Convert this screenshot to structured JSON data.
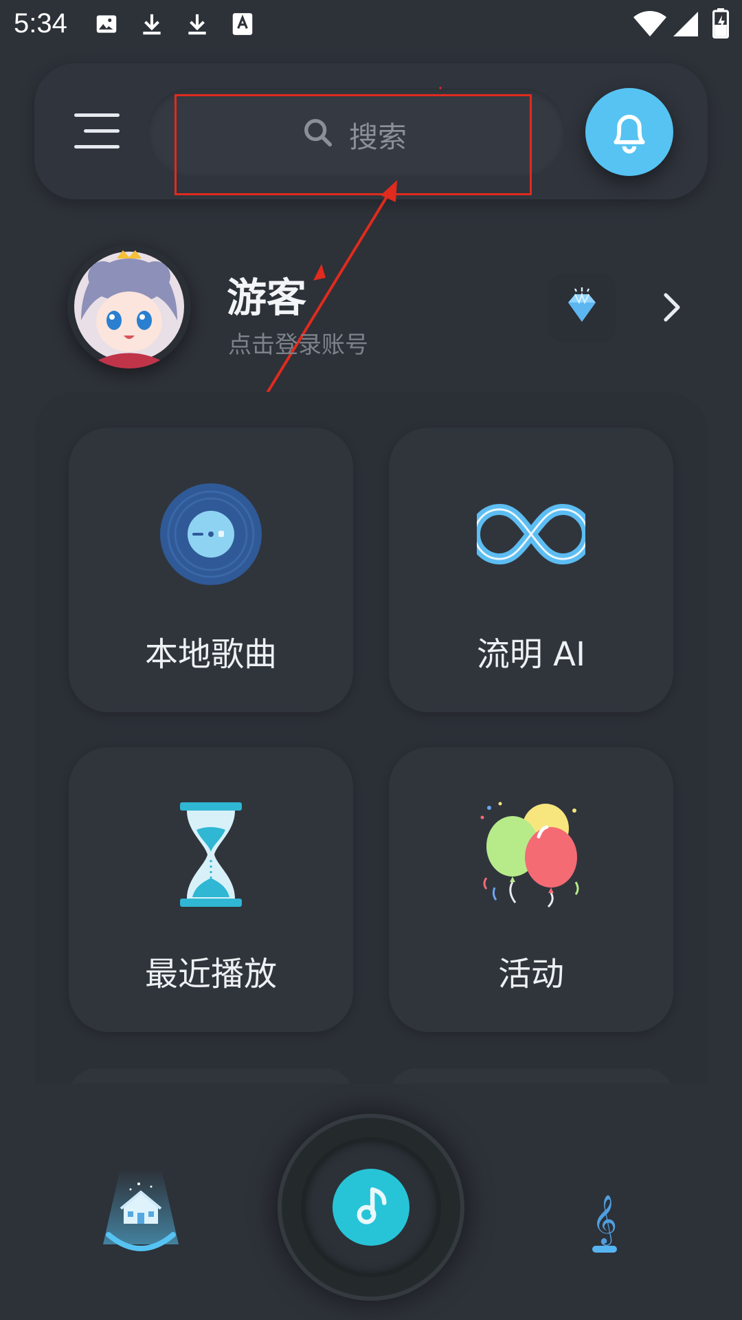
{
  "status_bar": {
    "time": "5:34",
    "left_icons": [
      "image-icon",
      "download-icon",
      "download-icon",
      "font-a-icon"
    ],
    "right_icons": [
      "wifi-icon",
      "signal-icon",
      "battery-charging-icon"
    ]
  },
  "header": {
    "menu_icon": "hamburger-icon",
    "search_placeholder": "搜索",
    "bell_icon": "bell-icon",
    "accent": "#56c3f2"
  },
  "profile": {
    "name": "游客",
    "subtitle": "点击登录账号",
    "vip_icon": "diamond-icon",
    "chevron_icon": "chevron-right-icon"
  },
  "tiles": [
    {
      "label": "本地歌曲",
      "icon": "vinyl-disc-icon"
    },
    {
      "label": "流明 AI",
      "icon": "infinity-icon"
    },
    {
      "label": "最近播放",
      "icon": "hourglass-icon"
    },
    {
      "label": "活动",
      "icon": "balloons-icon"
    }
  ],
  "bottom_nav": {
    "items": [
      {
        "icon": "home-icon",
        "active": true
      },
      {
        "icon": "music-note-icon"
      },
      {
        "icon": "treble-clef-icon"
      }
    ],
    "accent": "#27c4d8"
  },
  "annotation": {
    "highlight_color": "#e02b1e"
  }
}
